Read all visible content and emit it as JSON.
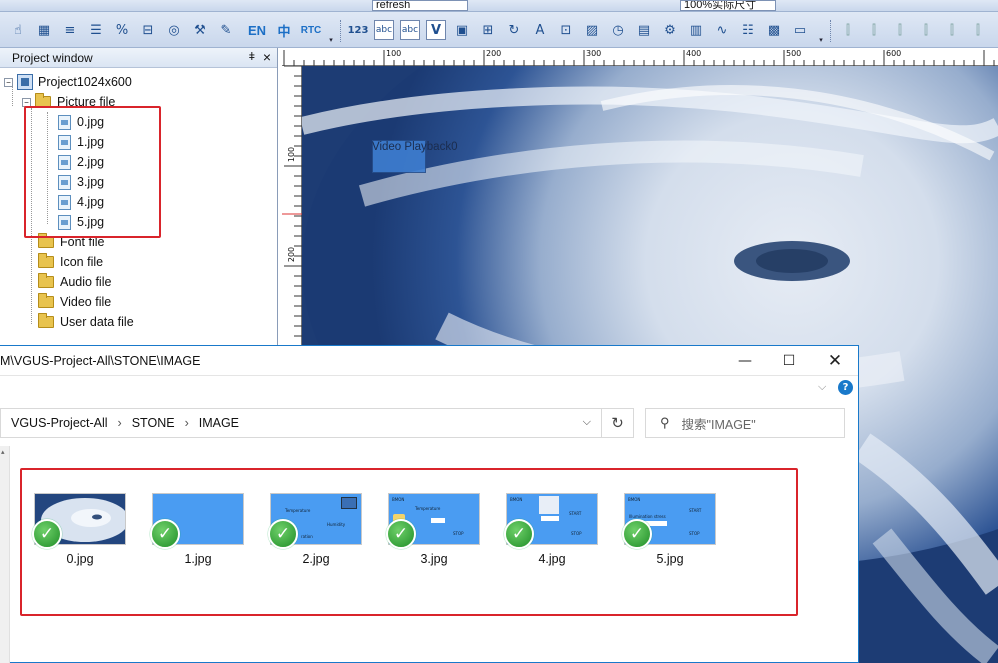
{
  "toolbar": {
    "top_dropdown_value": "refresh",
    "zoom_value": "100%实际尺寸",
    "btn_en": "EN",
    "btn_zh": "中",
    "btn_rtc": "RTC",
    "btn_123": "123",
    "btn_abc": "abc"
  },
  "project_window": {
    "title": "Project window",
    "pin_glyph": "📌",
    "close_glyph": "×",
    "project_name": "Project1024x600",
    "folders": {
      "picture": "Picture file",
      "font": "Font file",
      "icon": "Icon file",
      "audio": "Audio file",
      "video": "Video file",
      "user": "User data file"
    },
    "pictures": [
      "0.jpg",
      "1.jpg",
      "2.jpg",
      "3.jpg",
      "4.jpg",
      "5.jpg"
    ]
  },
  "ruler": {
    "h_labels": [
      "100",
      "200",
      "300",
      "400",
      "500",
      "600"
    ],
    "v_labels": [
      "100",
      "200"
    ]
  },
  "canvas": {
    "video_label": "Video Playback0"
  },
  "explorer": {
    "title": "M\\VGUS-Project-All\\STONE\\IMAGE",
    "breadcrumb": [
      "VGUS-Project-All",
      "STONE",
      "IMAGE"
    ],
    "search_placeholder": "搜索\"IMAGE\"",
    "files": [
      {
        "name": "0.jpg",
        "kind": "hurricane"
      },
      {
        "name": "1.jpg",
        "kind": "blue"
      },
      {
        "name": "2.jpg",
        "kind": "temperature-humidity"
      },
      {
        "name": "3.jpg",
        "kind": "temperature-stop"
      },
      {
        "name": "4.jpg",
        "kind": "weather-start-stop"
      },
      {
        "name": "5.jpg",
        "kind": "illumination-start-stop"
      }
    ],
    "thumb_text": {
      "temperature": "Temperature",
      "humidity": "Humidity",
      "ration": "ration",
      "stop": "STOP",
      "start": "START",
      "bmon": "BMON",
      "illumination": "Illumination stress"
    }
  },
  "colors": {
    "accent_blue": "#1979ca",
    "highlight_red": "#d9242b",
    "thumb_blue": "#4a9cf2",
    "check_green": "#1f8e27"
  }
}
